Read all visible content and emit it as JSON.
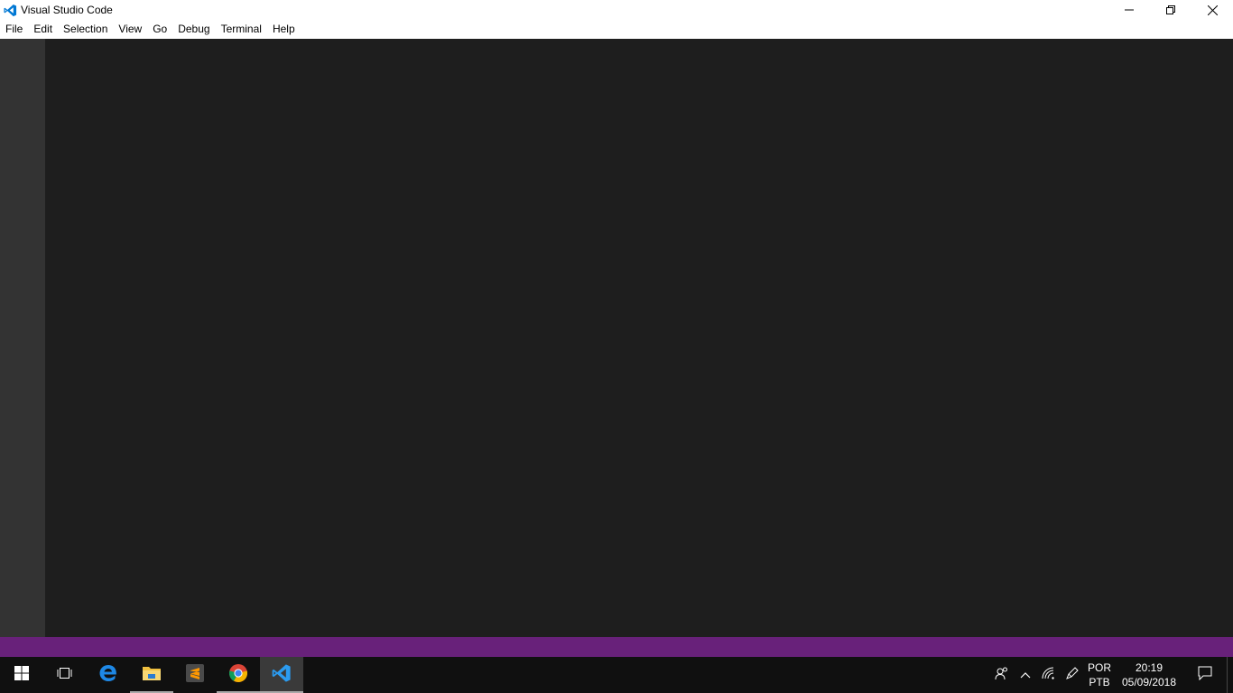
{
  "window": {
    "title": "Visual Studio Code",
    "minimize_glyph": "—",
    "restore_glyph": "❐",
    "close_glyph": "✕"
  },
  "menu": [
    "File",
    "Edit",
    "Selection",
    "View",
    "Go",
    "Debug",
    "Terminal",
    "Help"
  ],
  "colors": {
    "activity_bar": "#333333",
    "editor": "#1e1e1e",
    "status_bar": "#68217a",
    "taskbar": "#101010"
  },
  "taskbar": {
    "apps": [
      "start-icon",
      "task-view-icon",
      "edge-icon",
      "file-explorer-icon",
      "sublime-text-icon",
      "chrome-icon",
      "vscode-icon"
    ],
    "language_line1": "POR",
    "language_line2": "PTB",
    "time": "20:19",
    "date": "05/09/2018"
  }
}
